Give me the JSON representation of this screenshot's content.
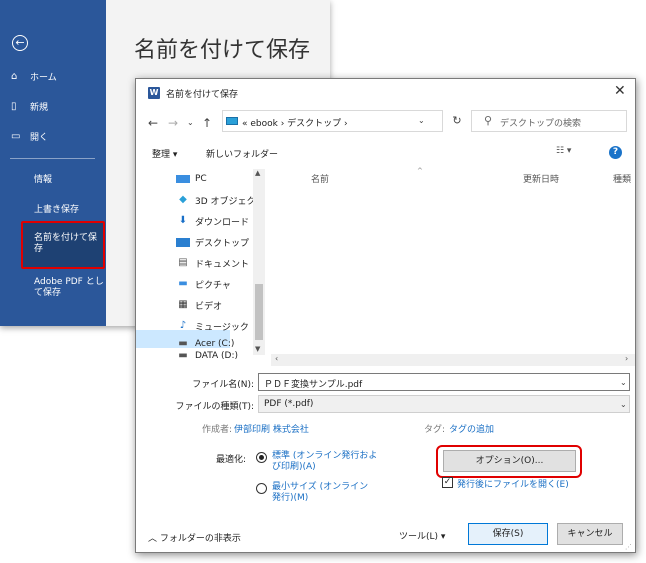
{
  "backstage": {
    "title": "名前を付けて保存",
    "back_glyph": "←",
    "menu": {
      "home": "ホーム",
      "new": "新規",
      "open": "開く",
      "info": "情報",
      "overwrite": "上書き保存",
      "save_as": "名前を付けて保存",
      "adobe_pdf": "Adobe PDF として保存"
    }
  },
  "dialog": {
    "app_logo": "W",
    "title": "名前を付けて保存",
    "close": "✕",
    "address": {
      "path": "« ebook › デスクトップ ›",
      "search_placeholder": "デスクトップの検索"
    },
    "toolbar": {
      "organize": "整理 ▾",
      "new_folder": "新しいフォルダー",
      "view": "☷ ▾",
      "help": "?"
    },
    "nav_items": [
      {
        "label": "PC",
        "icon": "pc-icon"
      },
      {
        "label": "3D オブジェクト",
        "icon": "3d-objects-icon"
      },
      {
        "label": "ダウンロード",
        "icon": "download-icon"
      },
      {
        "label": "デスクトップ",
        "icon": "desktop-icon"
      },
      {
        "label": "ドキュメント",
        "icon": "document-icon"
      },
      {
        "label": "ピクチャ",
        "icon": "picture-icon"
      },
      {
        "label": "ビデオ",
        "icon": "video-icon"
      },
      {
        "label": "ミュージック",
        "icon": "music-icon"
      },
      {
        "label": "Acer (C:)",
        "icon": "drive-icon"
      },
      {
        "label": "DATA (D:)",
        "icon": "drive-icon"
      }
    ],
    "columns": {
      "name": "名前",
      "modified": "更新日時",
      "type": "種類"
    },
    "file_name_label": "ファイル名(N):",
    "file_name_value": "ＰＤＦ変換サンプル.pdf",
    "file_type_label": "ファイルの種類(T):",
    "file_type_value": "PDF (*.pdf)",
    "author_label": "作成者:",
    "author_value": "伊部印刷 株式会社",
    "tags_label": "タグ:",
    "tags_value": "タグの追加",
    "optimize_label": "最適化:",
    "optimize_standard": "標準 (オンライン発行および印刷)(A)",
    "optimize_min": "最小サイズ (オンライン発行)(M)",
    "options_button": "オプション(O)...",
    "open_after_publish": "発行後にファイルを開く(E)",
    "hide_folders": "フォルダーの非表示",
    "tools": "ツール(L)",
    "save_button": "保存(S)",
    "cancel_button": "キャンセル"
  },
  "colors": {
    "word_blue": "#2b579a",
    "highlight_red": "#e00000",
    "link_blue": "#1a6fc4",
    "nav_selected": "#cce8ff"
  }
}
